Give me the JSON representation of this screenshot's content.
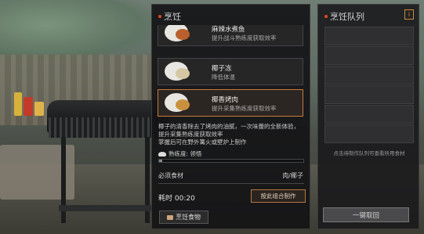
{
  "panel": {
    "title": "烹饪",
    "recipes": [
      {
        "name": "麻辣水煮鱼",
        "desc": "提升战斗熟练度获取效率",
        "food_color": "#b9602c"
      },
      {
        "name": "椰子冻",
        "desc": "降低体温",
        "food_color": "#d6c7a4"
      },
      {
        "name": "椰香烤肉",
        "desc": "提升采集熟练度获取效率",
        "food_color": "#c9913e"
      }
    ],
    "description": "椰子的清香除去了烤肉的油腻，一次味蕾的全新体验，提升采集熟练度获取效率\n掌握后可在野外篝火或壁炉上制作",
    "proficiency_label": "熟练度: 领悟",
    "proficiency_progress": 0.02,
    "ingredients_label": "必须食材",
    "ingredients_value": "肉/椰子",
    "time_label": "耗时 00:20",
    "craft_button": "按此组合制作",
    "food_tab": "烹饪食物"
  },
  "queue": {
    "title": "烹饪队列",
    "info_icon": "i",
    "slots": 6,
    "hint": "点击待制作队列可查看所用食材",
    "retrieve_button": "一键取回"
  },
  "colors": {
    "accent": "#e14a1f",
    "selected_border": "#c77a3a"
  }
}
